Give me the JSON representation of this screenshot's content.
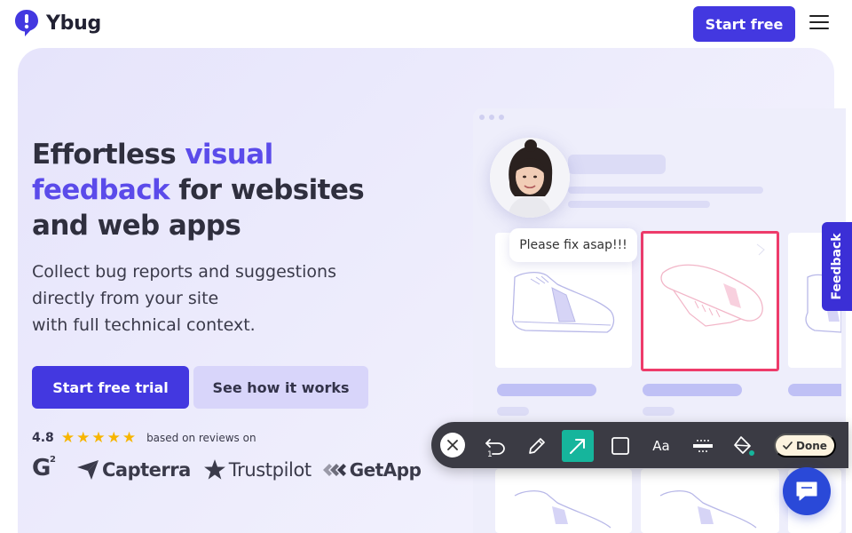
{
  "header": {
    "brand": "Ybug",
    "cta_label": "Start free"
  },
  "hero": {
    "headline_part1": "Effortless ",
    "headline_accent1": "visual",
    "headline_accent2": "feedback",
    "headline_part2": " for websites",
    "headline_part3": "and web apps",
    "subtext_lines": [
      "Collect bug reports and suggestions",
      "directly from your site",
      "with full technical context."
    ],
    "primary_button": "Start free trial",
    "secondary_button": "See how it works",
    "rating": {
      "value": "4.8",
      "stars": 5,
      "text": "based on reviews on"
    },
    "review_sites": {
      "g2": "G",
      "g2_sup": "2",
      "capterra": "Capterra",
      "trustpilot": "Trustpilot",
      "getapp": "GetApp"
    }
  },
  "illustration": {
    "comment": "Please fix asap!!!",
    "undo_count": "1",
    "text_tool_label": "Aa",
    "done_label": "Done"
  },
  "feedback_tab": {
    "label": "Feedback"
  },
  "colors": {
    "brand": "#4338e0",
    "accent_text": "#5b4bea",
    "highlight": "#ee3b6a",
    "active_tool": "#16b59c",
    "star": "#f7b500"
  },
  "icons": {
    "menu": "hamburger-icon",
    "chat": "chat-icon",
    "close": "close-icon",
    "undo": "undo-icon",
    "pen": "pen-icon",
    "arrow": "arrow-icon",
    "rect": "rectangle-icon",
    "blur": "blur-icon",
    "fill": "paint-bucket-icon",
    "check": "check-icon"
  }
}
